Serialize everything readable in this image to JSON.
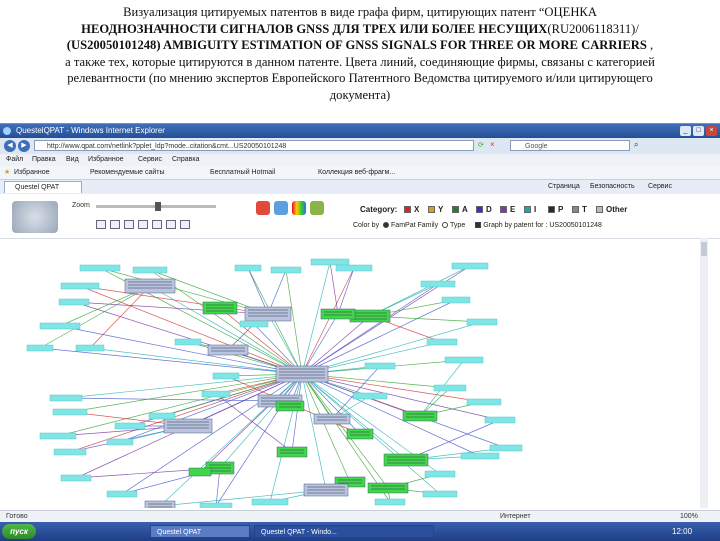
{
  "caption": {
    "line1": "Визуализация цитируемых патентов в виде графа фирм, цитирующих патент “ОЦЕНКА",
    "line2_bold": "НЕОДНОЗНАЧНОСТИ СИГНАЛОВ GNSS ДЛЯ ТРЕХ ИЛИ БОЛЕЕ НЕСУЩИХ",
    "line2_rest": "(RU2006118311)/",
    "line3_bold": "(US20050101248)  AMBIGUITY ESTIMATION OF GNSS SIGNALS FOR THREE OR MORE CARRIERS",
    "line3_rest": " ,",
    "line4": "а также тех, которые цитируются в данном патенте. Цвета линий, соединяющие фирмы, связаны с категорией",
    "line5": "релевантности (по мнению экспертов Европейского Патентного Ведомства цитируемого и/или цитирующего",
    "line6": "документа)"
  },
  "browser": {
    "title": "QuestelQPAT - Windows Internet Explorer",
    "address": "http://www.qpat.com/netlink?pplet_ldp?mode..citation&cmt...US20050101248",
    "search_placeholder": "Google",
    "menu": [
      "Файл",
      "Правка",
      "Вид",
      "Избранное",
      "Сервис",
      "Справка"
    ],
    "favorites_label": "Избранное",
    "favorites": [
      "Рекомендуемые сайты",
      "Бесплатный Hotmail",
      "Коллекция веб-фрагм..."
    ],
    "tab_label": "Questel QPAT",
    "right_menu": [
      "Страница",
      "Безопасность",
      "Сервис"
    ]
  },
  "app": {
    "zoom_label": "Zoom",
    "category_label": "Category:",
    "categories": [
      {
        "code": "X",
        "color": "#e02020"
      },
      {
        "code": "Y",
        "color": "#e09a20"
      },
      {
        "code": "A",
        "color": "#2a7a2a"
      },
      {
        "code": "D",
        "color": "#3333cc"
      },
      {
        "code": "E",
        "color": "#7a3aa8"
      },
      {
        "code": "I",
        "color": "#20a8a8"
      },
      {
        "code": "P",
        "color": "#2a2a2a"
      },
      {
        "code": "T",
        "color": "#888888"
      },
      {
        "code": "Other",
        "color": "#bbbbbb"
      }
    ],
    "colorby_label": "Color by",
    "colorby_option1": "FamPat Family",
    "colorby_option2": "Type",
    "graph_by_patent": "Graph by patent for : US20050101248"
  },
  "status": {
    "left": "Готово",
    "right": "Интернет",
    "zoom": "100%"
  },
  "taskbar": {
    "start": "пуск",
    "tasks": [
      "Questel QPAT",
      "Questel QPAT - Windo..."
    ],
    "time": "12:00"
  }
}
